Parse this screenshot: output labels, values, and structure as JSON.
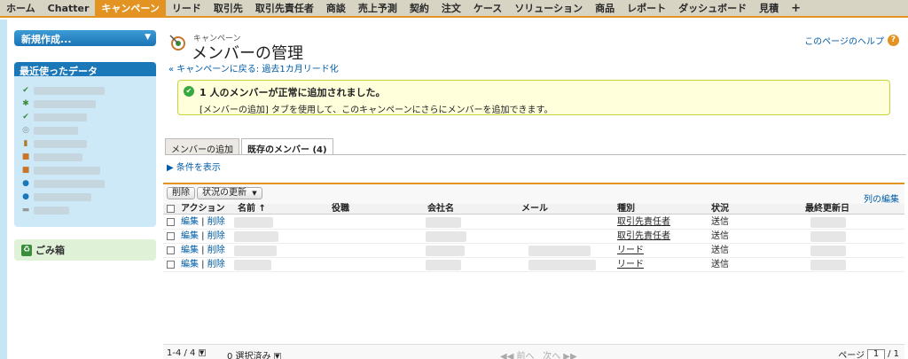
{
  "nav": {
    "tabs": [
      "ホーム",
      "Chatter",
      "キャンペーン",
      "リード",
      "取引先",
      "取引先責任者",
      "商談",
      "売上予測",
      "契約",
      "注文",
      "ケース",
      "ソリューション",
      "商品",
      "レポート",
      "ダッシュボード",
      "見積",
      "+"
    ],
    "active": 2
  },
  "sidebar": {
    "new_label": "新規作成...",
    "recent_title": "最近使ったデータ",
    "trash_label": "ごみ箱"
  },
  "header": {
    "supertitle": "キャンペーン",
    "title": "メンバーの管理",
    "back_link": "« キャンペーンに戻る: 過去1カ月リード化",
    "help": "このページのヘルプ"
  },
  "banner": {
    "main": "1 人のメンバーが正常に追加されました。",
    "sub": "[メンバーの追加] タブを使用して、このキャンペーンにさらにメンバーを追加できます。"
  },
  "tabs": {
    "add": "メンバーの追加",
    "existing": "既存のメンバー (4)",
    "show_filters": "条件を表示"
  },
  "list": {
    "delete_btn": "削除",
    "status_btn": "状況の更新",
    "column_edit": "列の編集",
    "columns": [
      "アクション",
      "名前 ↑",
      "役職",
      "会社名",
      "メール",
      "種別",
      "状況",
      "最終更新日"
    ],
    "edit_label": "編集",
    "delete_label": "削除",
    "rows": [
      {
        "type": "取引先責任者",
        "status": "送信"
      },
      {
        "type": "取引先責任者",
        "status": "送信"
      },
      {
        "type": "リード",
        "status": "送信"
      },
      {
        "type": "リード",
        "status": "送信"
      }
    ],
    "record_count": "1-4 / 4",
    "selected": "0 選択済み",
    "prev": "◀◀ 前へ",
    "next": "次へ ▶▶",
    "page_label": "ページ",
    "page_num": "1",
    "page_total": "/ 1"
  },
  "colors": {
    "accent": "#e39321",
    "link": "#015ba7",
    "banner_bg": "#ffffdc"
  }
}
